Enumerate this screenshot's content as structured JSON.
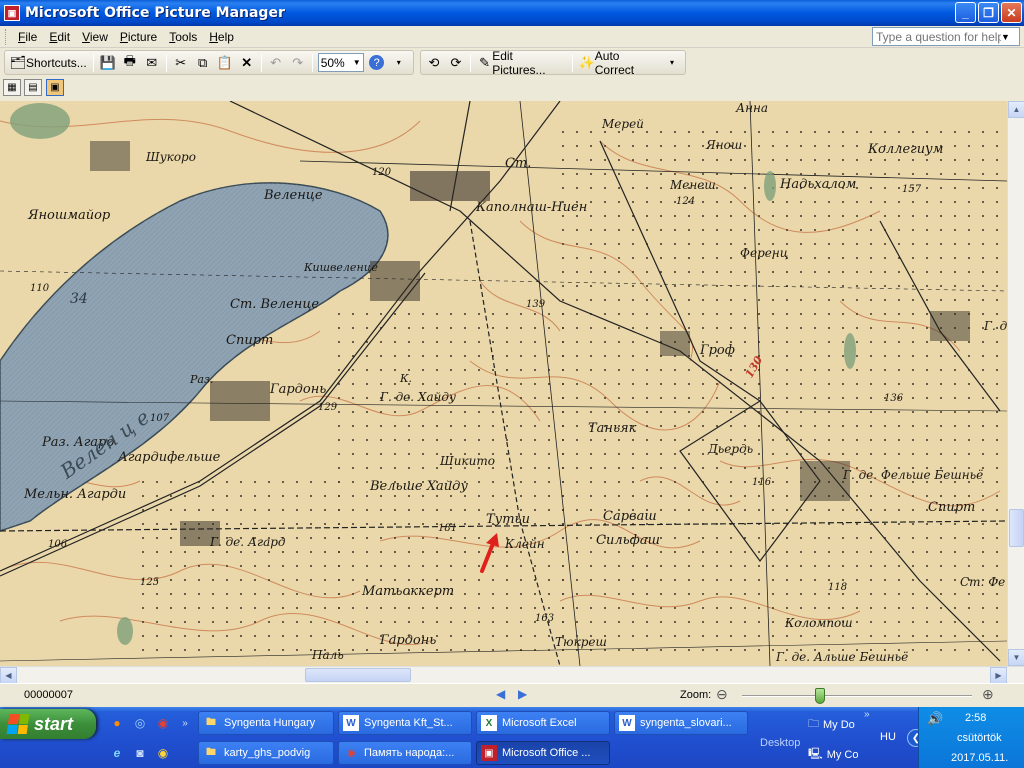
{
  "window": {
    "title": "Microsoft Office Picture Manager",
    "icon": "picture-manager-icon",
    "buttons": {
      "minimize": "minimize-icon",
      "restore": "restore-icon",
      "close": "close-icon"
    }
  },
  "menu": {
    "items": [
      {
        "label": "File"
      },
      {
        "label": "Edit"
      },
      {
        "label": "View"
      },
      {
        "label": "Picture"
      },
      {
        "label": "Tools"
      },
      {
        "label": "Help"
      }
    ],
    "help_placeholder": "Type a question for help"
  },
  "toolbar": {
    "shortcuts_label": "Shortcuts...",
    "zoom_value": "50%",
    "edit_pictures_label": "Edit Pictures...",
    "auto_correct_label": "Auto Correct"
  },
  "map": {
    "places": [
      "Шукоро",
      "Веленце",
      "Яношмайор",
      "Кишвеленце",
      "Ст. Веленце",
      "Спирт",
      "Раз.",
      "Гардонь",
      "Раз. Агард",
      "Агардифельше",
      "Мельн. Агарди",
      "Г. де. Агард",
      "Каполнаш-Ниен",
      "Ст.",
      "Мерей",
      "Янош",
      "Анна",
      "Менеш",
      "Надьхалом",
      "Коллегиум",
      "Ференц",
      "Гроф",
      "Г. де.",
      "К.",
      "Г. де. Хайду",
      "Таньяк",
      "Дьердь",
      "Шикито",
      "Вельше Хайду",
      "Тутьи",
      "Клейн",
      "Сарваш",
      "Сильфаш",
      "Г. де. Фельше Бешньё",
      "Спирт",
      "Матьоккерт",
      "Тюкреш",
      "Гардонь",
      "Паль",
      "Ст. Фе",
      "Коломпош",
      "Г. де. Альше Бешньё",
      "Велен ц е"
    ],
    "elevations": [
      "120",
      "124",
      "157",
      "110",
      "34",
      "107",
      "129",
      "139",
      "136",
      "116",
      "118",
      "106",
      "125",
      "181",
      "163",
      "130"
    ]
  },
  "status": {
    "counter": "00000007",
    "zoom_label": "Zoom:"
  },
  "taskbar": {
    "start_label": "start",
    "buttons_row1": [
      {
        "label": "Syngenta Hungary",
        "icon": "folder-icon"
      },
      {
        "label": "Syngenta Kft_St...",
        "icon": "word-doc-icon"
      },
      {
        "label": "Microsoft Excel",
        "icon": "excel-icon"
      },
      {
        "label": "syngenta_slovari...",
        "icon": "word-doc-icon"
      }
    ],
    "buttons_row2": [
      {
        "label": "karty_ghs_podvig",
        "icon": "folder-icon"
      },
      {
        "label": "Память народа:...",
        "icon": "chrome-icon"
      },
      {
        "label": "Microsoft Office ...",
        "icon": "picture-manager-icon"
      }
    ],
    "desktop_toolbar": {
      "label": "Desktop",
      "items": [
        "My Do",
        "My Co"
      ]
    },
    "language": "HU",
    "time": "2:58",
    "day": "csütörtök",
    "date": "2017.05.11."
  },
  "colors": {
    "map_paper": "#e9d7a8",
    "lake": "#8fa3b3",
    "contours": "#c9774a",
    "marker": "#e0201a"
  }
}
